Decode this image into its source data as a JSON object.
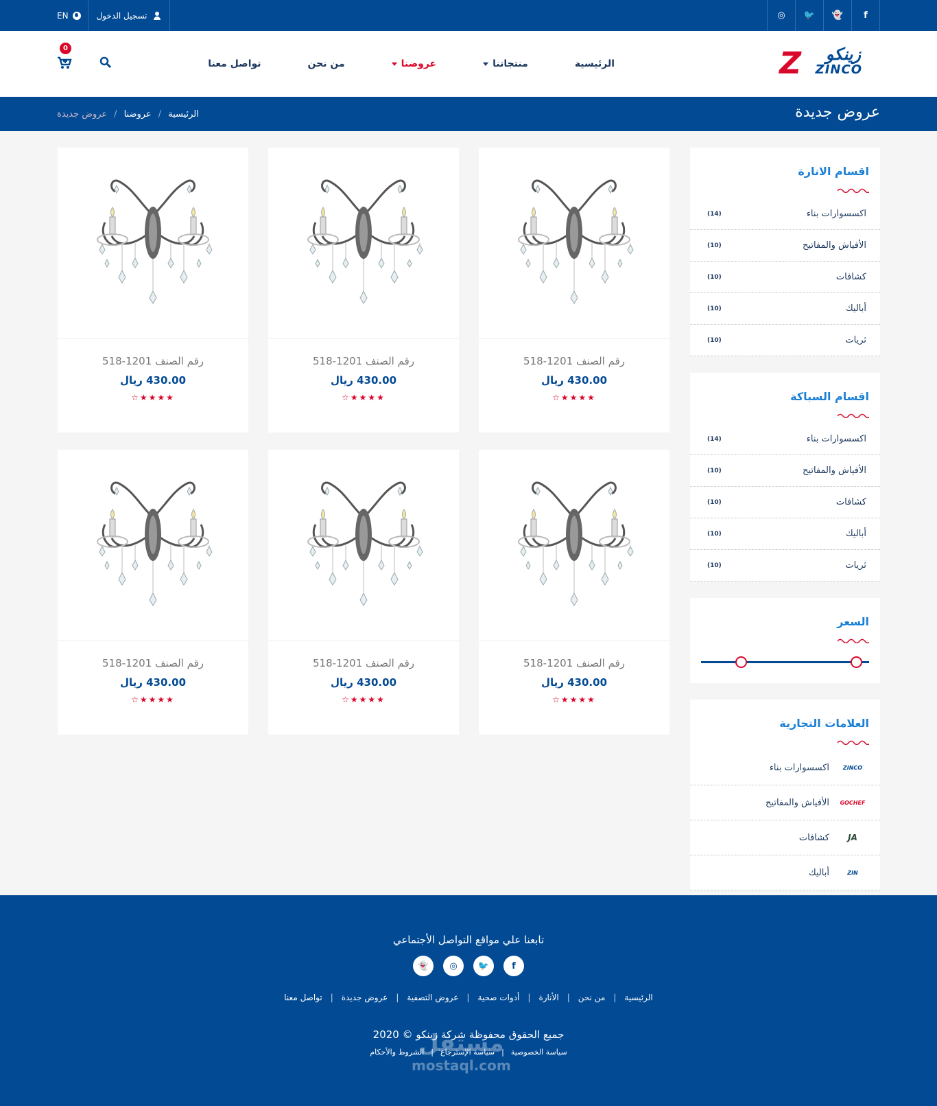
{
  "topbar": {
    "social": [
      "f",
      "👻",
      "🐦",
      "◎"
    ],
    "login": "تسجيل الدخول",
    "lang": "EN"
  },
  "header": {
    "logo_ar": "زينكو",
    "logo_en": "ZINCO",
    "nav": [
      "الرئيسية",
      "منتجاتنا",
      "عروضنا",
      "من نحن",
      "تواصل معنا"
    ],
    "cart_count": "0"
  },
  "titlebar": {
    "title": "عروض جديدة",
    "breadcrumb": [
      "الرئيسية",
      "عروضنا",
      "عروض جديدة"
    ]
  },
  "sidebar": {
    "lighting": {
      "title": "اقسام الانارة",
      "items": [
        {
          "name": "اكسسوارات بناء",
          "count": "(14)"
        },
        {
          "name": "الأفياش والمفاتيح",
          "count": "(10)"
        },
        {
          "name": "كشافات",
          "count": "(10)"
        },
        {
          "name": "أباليك",
          "count": "(10)"
        },
        {
          "name": "ثريات",
          "count": "(10)"
        }
      ]
    },
    "plumbing": {
      "title": "اقسام السباكة",
      "items": [
        {
          "name": "اكسسوارات بناء",
          "count": "(14)"
        },
        {
          "name": "الأفياش والمفاتيح",
          "count": "(10)"
        },
        {
          "name": "كشافات",
          "count": "(10)"
        },
        {
          "name": "أباليك",
          "count": "(10)"
        },
        {
          "name": "ثريات",
          "count": "(10)"
        }
      ]
    },
    "price": {
      "title": "السعر"
    },
    "brands": {
      "title": "العلامات التجارية",
      "items": [
        {
          "name": "اكسسوارات بناء",
          "logo": "ZINCO"
        },
        {
          "name": "الأفياش والمفاتيح",
          "logo": "GOCHEF"
        },
        {
          "name": "كشافات",
          "logo": "JA"
        },
        {
          "name": "أباليك",
          "logo": "ZIN"
        }
      ]
    }
  },
  "products": [
    {
      "code": "رقم الصنف 1201-518",
      "price": "430.00 ريال",
      "rating": 4
    },
    {
      "code": "رقم الصنف 1201-518",
      "price": "430.00 ريال",
      "rating": 4
    },
    {
      "code": "رقم الصنف 1201-518",
      "price": "430.00 ريال",
      "rating": 4
    },
    {
      "code": "رقم الصنف 1201-518",
      "price": "430.00 ريال",
      "rating": 4
    },
    {
      "code": "رقم الصنف 1201-518",
      "price": "430.00 ريال",
      "rating": 4
    },
    {
      "code": "رقم الصنف 1201-518",
      "price": "430.00 ريال",
      "rating": 4
    }
  ],
  "footer": {
    "follow": "تابعنا علي مواقع التواصل الأجتماعي",
    "social": [
      "f",
      "🐦",
      "◎",
      "👻"
    ],
    "links": [
      "الرئيسية",
      "من نحن",
      "الأنارة",
      "أدوات صحية",
      "عروض التصفية",
      "عروض جديدة",
      "تواصل معنا"
    ],
    "copyright": "جميع الحقوق محفوظة شركة زينكو © 2020",
    "legal": [
      "سياسة الخصوصية",
      "سياسة الإسترجاع",
      "الشروط والأحكام"
    ],
    "watermark": "مستقل",
    "watermark_url": "mostaql.com"
  },
  "colors": {
    "primary": "#024a94",
    "accent": "#d9082b"
  }
}
